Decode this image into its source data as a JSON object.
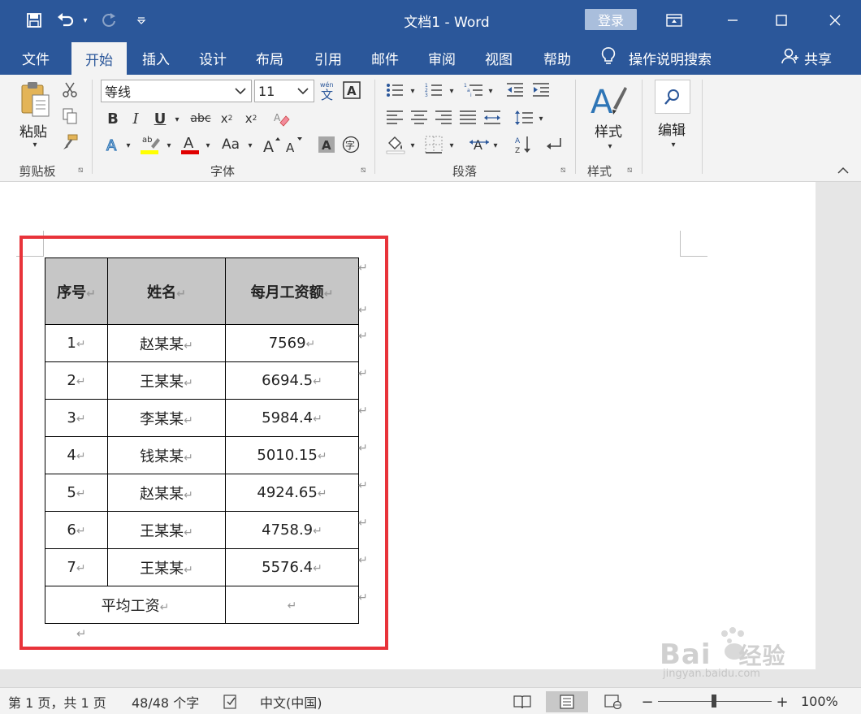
{
  "window": {
    "title": "文档1  -  Word",
    "login_label": "登录"
  },
  "tabs": [
    {
      "label": "文件"
    },
    {
      "label": "开始"
    },
    {
      "label": "插入"
    },
    {
      "label": "设计"
    },
    {
      "label": "布局"
    },
    {
      "label": "引用"
    },
    {
      "label": "邮件"
    },
    {
      "label": "审阅"
    },
    {
      "label": "视图"
    },
    {
      "label": "帮助"
    }
  ],
  "tell_me": "操作说明搜索",
  "share_label": "共享",
  "ribbon": {
    "clipboard": {
      "label": "剪贴板",
      "paste_label": "粘贴"
    },
    "font": {
      "label": "字体",
      "font_name": "等线",
      "font_size": "11"
    },
    "paragraph": {
      "label": "段落"
    },
    "styles": {
      "label": "样式",
      "button_label": "样式"
    },
    "editing": {
      "button_label": "编辑"
    }
  },
  "table": {
    "headers": [
      "序号",
      "姓名",
      "每月工资额"
    ],
    "rows": [
      [
        "1",
        "赵某某",
        "7569"
      ],
      [
        "2",
        "王某某",
        "6694.5"
      ],
      [
        "3",
        "李某某",
        "5984.4"
      ],
      [
        "4",
        "钱某某",
        "5010.15"
      ],
      [
        "5",
        "赵某某",
        "4924.65"
      ],
      [
        "6",
        "王某某",
        "4758.9"
      ],
      [
        "7",
        "王某某",
        "5576.4"
      ]
    ],
    "footer_label": "平均工资",
    "footer_value": ""
  },
  "status": {
    "page": "第 1 页，共 1 页",
    "words": "48/48 个字",
    "language": "中文(中国)",
    "zoom": "100%"
  },
  "watermark": {
    "brand": "Bai",
    "brand_cn": "经验",
    "url": "jingyan.baidu.com"
  },
  "colors": {
    "accent": "#2b579a",
    "highlight_border": "#e8333a",
    "header_fill": "#c6c6c6"
  }
}
